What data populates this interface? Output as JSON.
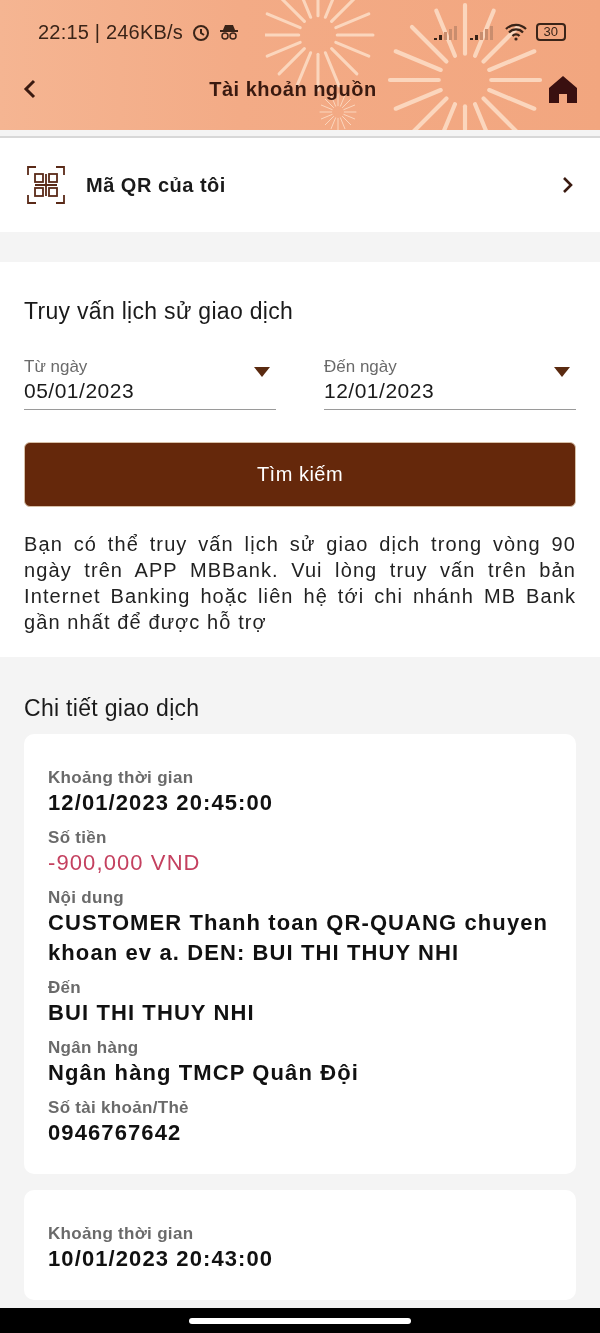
{
  "status_bar": {
    "time": "22:15 | 246KB/s",
    "battery": "30"
  },
  "header": {
    "title": "Tài khoản nguồn"
  },
  "qr_row": {
    "label": "Mã QR của tôi"
  },
  "query": {
    "title": "Truy vấn lịch sử giao dịch",
    "dates": [
      {
        "label": "Từ ngày",
        "value": "05/01/2023"
      },
      {
        "label": "Đến ngày",
        "value": "12/01/2023"
      }
    ],
    "button": "Tìm kiếm",
    "note": "Bạn có thể truy vấn lịch sử giao dịch trong vòng 90 ngày trên APP MBBank. Vui lòng truy vấn trên bản Internet Banking hoặc liên hệ tới chi nhánh MB Bank gần nhất để được hỗ trợ"
  },
  "details": {
    "title": "Chi tiết giao dịch",
    "transactions": [
      {
        "fields": [
          {
            "label": "Khoảng thời gian",
            "value": "12/01/2023 20:45:00",
            "kind": "plain"
          },
          {
            "label": "Số tiền",
            "value": "-900,000 VND",
            "kind": "debit"
          },
          {
            "label": "Nội dung",
            "value": "CUSTOMER Thanh toan QR-QUANG chuyen khoan ev a. DEN: BUI THI THUY NHI",
            "kind": "plain"
          },
          {
            "label": "Đến",
            "value": "BUI THI THUY NHI",
            "kind": "plain"
          },
          {
            "label": "Ngân hàng",
            "value": "Ngân hàng TMCP Quân Đội",
            "kind": "plain"
          },
          {
            "label": "Số tài khoản/Thẻ",
            "value": "0946767642",
            "kind": "plain"
          }
        ]
      },
      {
        "fields": [
          {
            "label": "Khoảng thời gian",
            "value": "10/01/2023 20:43:00",
            "kind": "plain"
          }
        ]
      }
    ]
  }
}
